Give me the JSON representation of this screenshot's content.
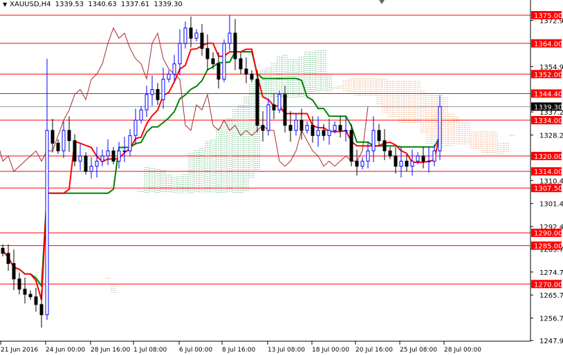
{
  "header": {
    "symbol": "XAUUSD,H4",
    "open": "1339.53",
    "high": "1340.63",
    "low": "1337.61",
    "close": "1339.30"
  },
  "colors": {
    "level": "#ff0000",
    "tenkan": "#ff0000",
    "kijun": "#008000",
    "chikou": "#a52a2a",
    "cloud_up": "#2e9e4e",
    "cloud_down": "#f08040",
    "bull": "#0000ff",
    "bear": "#000000",
    "current": "#000000"
  },
  "chart_data": {
    "type": "line",
    "title": "XAUUSD,H4",
    "indicator": "Ichimoku Kinko Hyo",
    "ylim": [
      1247.95,
      1375.0
    ],
    "y_ticks": [
      "1372.95",
      "1354.95",
      "1337.20",
      "1328.20",
      "1310.45",
      "1301.45",
      "1292.45",
      "1283.70",
      "1274.70",
      "1265.70",
      "1256.70",
      "1247.95"
    ],
    "x_ticks": [
      "21 Jun 2016",
      "24 Jun 00:00",
      "28 Jun 16:00",
      "1 Jul 08:00",
      "6 Jul 00:00",
      "8 Jul 16:00",
      "13 Jul 08:00",
      "18 Jul 00:00",
      "20 Jul 16:00",
      "25 Jul 08:00",
      "28 Jul 00:00"
    ],
    "levels": [
      "1375.00",
      "1364.00",
      "1352.00",
      "1344.40",
      "1334.00",
      "1320.00",
      "1314.00",
      "1307.50",
      "1290.00",
      "1285.00",
      "1270.00"
    ],
    "current_price": "1339.30",
    "closes": [
      1282,
      1278,
      1272,
      1268,
      1266,
      1265,
      1262,
      1258,
      1330,
      1325,
      1322,
      1330,
      1326,
      1318,
      1320,
      1314,
      1316,
      1318,
      1320,
      1322,
      1318,
      1322,
      1322,
      1328,
      1334,
      1338,
      1344,
      1346,
      1342,
      1350,
      1352,
      1356,
      1364,
      1370,
      1366,
      1368,
      1362,
      1358,
      1356,
      1350,
      1364,
      1368,
      1358,
      1354,
      1352,
      1350,
      1332,
      1330,
      1340,
      1338,
      1344,
      1332,
      1330,
      1334,
      1330,
      1332,
      1328,
      1330,
      1328,
      1330,
      1332,
      1330,
      1330,
      1318,
      1316,
      1318,
      1322,
      1330,
      1326,
      1322,
      1320,
      1316,
      1318,
      1316,
      1318,
      1320,
      1318,
      1318,
      1322,
      1339.3
    ]
  }
}
